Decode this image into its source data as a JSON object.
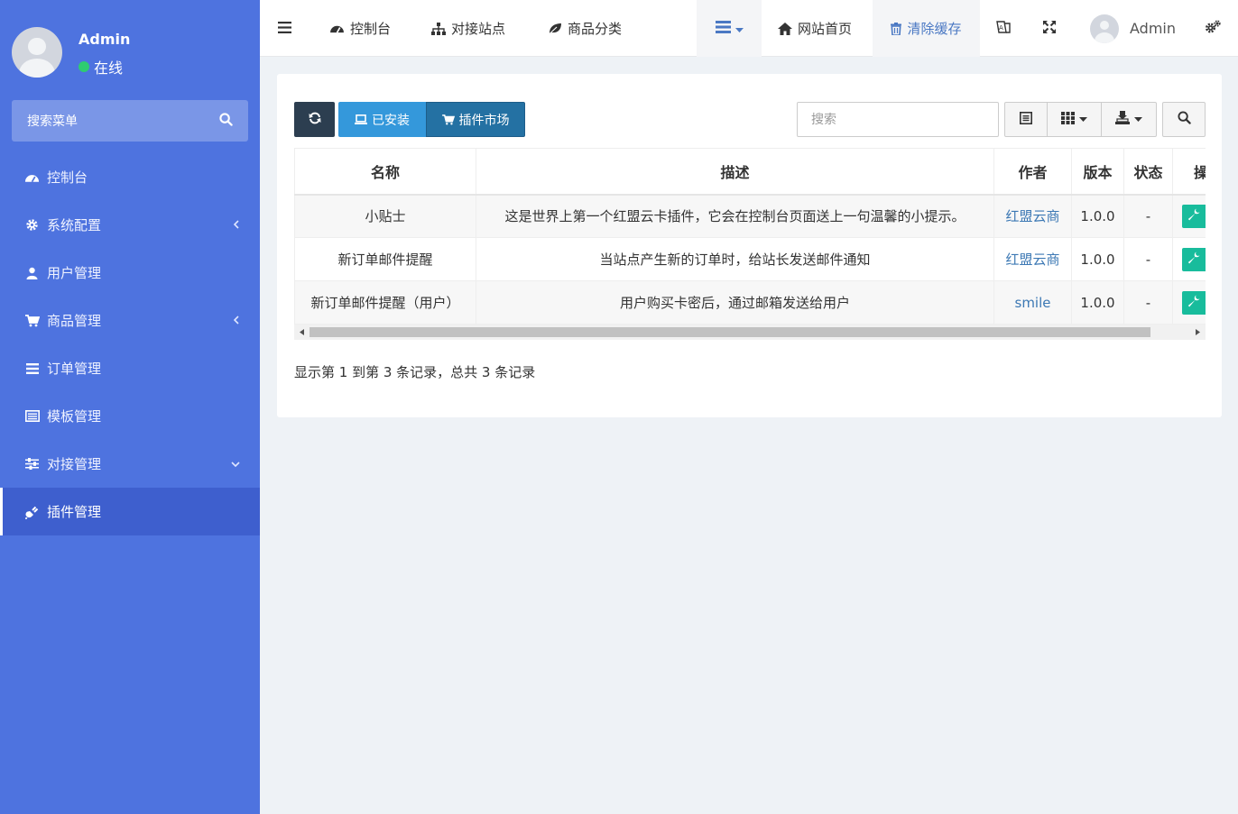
{
  "sidebar": {
    "user": {
      "name": "Admin",
      "status": "在线",
      "status_color": "#2ecc71"
    },
    "search_placeholder": "搜索菜单",
    "items": [
      {
        "label": "控制台",
        "icon": "dashboard-icon"
      },
      {
        "label": "系统配置",
        "icon": "gear-icon"
      },
      {
        "label": "用户管理",
        "icon": "user-icon"
      },
      {
        "label": "商品管理",
        "icon": "cart-icon"
      },
      {
        "label": "订单管理",
        "icon": "list-icon"
      },
      {
        "label": "模板管理",
        "icon": "template-icon"
      },
      {
        "label": "对接管理",
        "icon": "sliders-icon"
      },
      {
        "label": "插件管理",
        "icon": "plug-icon"
      }
    ],
    "active_item": "插件管理",
    "accent": "#4e73df"
  },
  "topbar": {
    "nav": [
      {
        "label": "控制台",
        "icon": "dashboard-icon"
      },
      {
        "label": "对接站点",
        "icon": "sitemap-icon"
      },
      {
        "label": "商品分类",
        "icon": "leaf-icon"
      }
    ],
    "site_home": "网站首页",
    "clear_cache": "清除缓存",
    "admin_name": "Admin"
  },
  "toolbar": {
    "installed_label": "已安装",
    "market_label": "插件市场",
    "search_placeholder": "搜索"
  },
  "table": {
    "columns": [
      "名称",
      "描述",
      "作者",
      "版本",
      "状态",
      "操"
    ],
    "rows": [
      {
        "name": "小贴士",
        "desc": "这是世界上第一个红盟云卡插件，它会在控制台页面送上一句温馨的小提示。",
        "author": "红盟云商",
        "version": "1.0.0",
        "status": "-"
      },
      {
        "name": "新订单邮件提醒",
        "desc": "当站点产生新的订单时，给站长发送邮件通知",
        "author": "红盟云商",
        "version": "1.0.0",
        "status": "-"
      },
      {
        "name": "新订单邮件提醒（用户）",
        "desc": "用户购买卡密后，通过邮箱发送给用户",
        "author": "smile",
        "version": "1.0.0",
        "status": "-"
      }
    ]
  },
  "summary": "显示第 1 到第 3 条记录，总共 3 条记录"
}
